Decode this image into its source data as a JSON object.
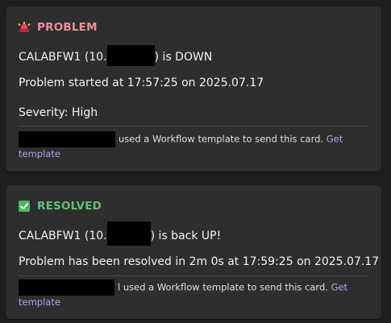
{
  "cards": [
    {
      "status_label": "PROBLEM",
      "status_icon": "siren-icon",
      "status_color": "#e8929a",
      "host_prefix": "CALABFW1 (10.",
      "host_suffix": ") is DOWN",
      "started_text": "Problem started at 17:57:25 on 2025.07.17",
      "severity_text": "Severity: High",
      "footer_text": "used a Workflow template to send this card.",
      "footer_link": "Get template"
    },
    {
      "status_label": "RESOLVED",
      "status_icon": "check-icon",
      "status_color": "#62c07a",
      "host_prefix": "CALABFW1 (10.",
      "host_suffix": ") is back UP!",
      "resolved_text": "Problem has been resolved in 2m 0s at 17:59:25 on 2025.07.17",
      "footer_text": "l used a Workflow template to send this card.",
      "footer_link": "Get template"
    }
  ],
  "colors": {
    "background": "#1f1f1f",
    "card": "#2e2e2e",
    "link": "#a8a8ee",
    "redaction": "#000000"
  }
}
